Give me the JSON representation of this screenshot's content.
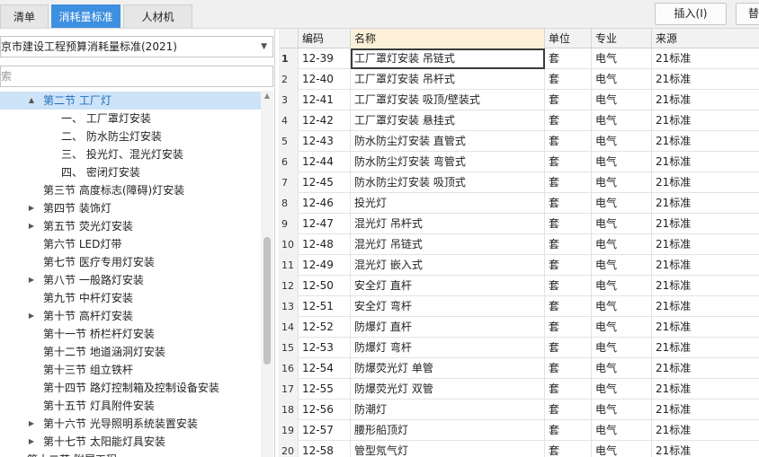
{
  "top_tabs": [
    {
      "label": "清单",
      "active": false
    },
    {
      "label": "消耗量标准",
      "active": true
    },
    {
      "label": "人材机",
      "active": false
    }
  ],
  "toolbar": {
    "insert_label": "插入(I)",
    "replace_label": "替"
  },
  "left": {
    "standard_select": "京市建设工程预算消耗量标准(2021)",
    "search_placeholder": "索",
    "tree": [
      {
        "label": "第二节 工厂灯",
        "level": 1,
        "toggle": "▲",
        "selected": true
      },
      {
        "label": "一、 工厂罩灯安装",
        "level": 2,
        "toggle": "",
        "selected": false
      },
      {
        "label": "二、 防水防尘灯安装",
        "level": 2,
        "toggle": "",
        "selected": false
      },
      {
        "label": "三、 投光灯、混光灯安装",
        "level": 2,
        "toggle": "",
        "selected": false
      },
      {
        "label": "四、 密闭灯安装",
        "level": 2,
        "toggle": "",
        "selected": false
      },
      {
        "label": "第三节 高度标志(障碍)灯安装",
        "level": 1,
        "toggle": "",
        "selected": false
      },
      {
        "label": "第四节 装饰灯",
        "level": 1,
        "toggle": "▶",
        "selected": false
      },
      {
        "label": "第五节 荧光灯安装",
        "level": 1,
        "toggle": "▶",
        "selected": false
      },
      {
        "label": "第六节 LED灯带",
        "level": 1,
        "toggle": "",
        "selected": false
      },
      {
        "label": "第七节 医疗专用灯安装",
        "level": 1,
        "toggle": "",
        "selected": false
      },
      {
        "label": "第八节 一般路灯安装",
        "level": 1,
        "toggle": "▶",
        "selected": false
      },
      {
        "label": "第九节 中杆灯安装",
        "level": 1,
        "toggle": "",
        "selected": false
      },
      {
        "label": "第十节 高杆灯安装",
        "level": 1,
        "toggle": "▶",
        "selected": false
      },
      {
        "label": "第十一节 桥栏杆灯安装",
        "level": 1,
        "toggle": "",
        "selected": false
      },
      {
        "label": "第十二节 地道涵洞灯安装",
        "level": 1,
        "toggle": "",
        "selected": false
      },
      {
        "label": "第十三节 组立铁杆",
        "level": 1,
        "toggle": "",
        "selected": false
      },
      {
        "label": "第十四节 路灯控制箱及控制设备安装",
        "level": 1,
        "toggle": "",
        "selected": false
      },
      {
        "label": "第十五节 灯具附件安装",
        "level": 1,
        "toggle": "",
        "selected": false
      },
      {
        "label": "第十六节 光导照明系统装置安装",
        "level": 1,
        "toggle": "▶",
        "selected": false
      },
      {
        "label": "第十七节 太阳能灯具安装",
        "level": 1,
        "toggle": "▶",
        "selected": false
      },
      {
        "label": "第十二节 附属工程",
        "level": 0,
        "toggle": "",
        "selected": false
      }
    ]
  },
  "table": {
    "headers": {
      "code": "编码",
      "name": "名称",
      "unit": "单位",
      "major": "专业",
      "source": "来源"
    },
    "rows": [
      {
        "no": "1",
        "code": "12-39",
        "name": "工厂罩灯安装 吊链式",
        "unit": "套",
        "major": "电气",
        "source": "21标准",
        "selected": true
      },
      {
        "no": "2",
        "code": "12-40",
        "name": "工厂罩灯安装 吊杆式",
        "unit": "套",
        "major": "电气",
        "source": "21标准",
        "selected": false
      },
      {
        "no": "3",
        "code": "12-41",
        "name": "工厂罩灯安装 吸顶/壁装式",
        "unit": "套",
        "major": "电气",
        "source": "21标准",
        "selected": false
      },
      {
        "no": "4",
        "code": "12-42",
        "name": "工厂罩灯安装 悬挂式",
        "unit": "套",
        "major": "电气",
        "source": "21标准",
        "selected": false
      },
      {
        "no": "5",
        "code": "12-43",
        "name": "防水防尘灯安装 直管式",
        "unit": "套",
        "major": "电气",
        "source": "21标准",
        "selected": false
      },
      {
        "no": "6",
        "code": "12-44",
        "name": "防水防尘灯安装 弯管式",
        "unit": "套",
        "major": "电气",
        "source": "21标准",
        "selected": false
      },
      {
        "no": "7",
        "code": "12-45",
        "name": "防水防尘灯安装 吸顶式",
        "unit": "套",
        "major": "电气",
        "source": "21标准",
        "selected": false
      },
      {
        "no": "8",
        "code": "12-46",
        "name": "投光灯",
        "unit": "套",
        "major": "电气",
        "source": "21标准",
        "selected": false
      },
      {
        "no": "9",
        "code": "12-47",
        "name": "混光灯 吊杆式",
        "unit": "套",
        "major": "电气",
        "source": "21标准",
        "selected": false
      },
      {
        "no": "10",
        "code": "12-48",
        "name": "混光灯 吊链式",
        "unit": "套",
        "major": "电气",
        "source": "21标准",
        "selected": false
      },
      {
        "no": "11",
        "code": "12-49",
        "name": "混光灯 嵌入式",
        "unit": "套",
        "major": "电气",
        "source": "21标准",
        "selected": false
      },
      {
        "no": "12",
        "code": "12-50",
        "name": "安全灯 直杆",
        "unit": "套",
        "major": "电气",
        "source": "21标准",
        "selected": false
      },
      {
        "no": "13",
        "code": "12-51",
        "name": "安全灯 弯杆",
        "unit": "套",
        "major": "电气",
        "source": "21标准",
        "selected": false
      },
      {
        "no": "14",
        "code": "12-52",
        "name": "防爆灯 直杆",
        "unit": "套",
        "major": "电气",
        "source": "21标准",
        "selected": false
      },
      {
        "no": "15",
        "code": "12-53",
        "name": "防爆灯 弯杆",
        "unit": "套",
        "major": "电气",
        "source": "21标准",
        "selected": false
      },
      {
        "no": "16",
        "code": "12-54",
        "name": "防爆荧光灯 单管",
        "unit": "套",
        "major": "电气",
        "source": "21标准",
        "selected": false
      },
      {
        "no": "17",
        "code": "12-55",
        "name": "防爆荧光灯 双管",
        "unit": "套",
        "major": "电气",
        "source": "21标准",
        "selected": false
      },
      {
        "no": "18",
        "code": "12-56",
        "name": "防潮灯",
        "unit": "套",
        "major": "电气",
        "source": "21标准",
        "selected": false
      },
      {
        "no": "19",
        "code": "12-57",
        "name": "腰形船顶灯",
        "unit": "套",
        "major": "电气",
        "source": "21标准",
        "selected": false
      },
      {
        "no": "20",
        "code": "12-58",
        "name": "管型氖气灯",
        "unit": "套",
        "major": "电气",
        "source": "21标准",
        "selected": false
      }
    ]
  },
  "colors": {
    "accent": "#3d8fe0",
    "tree_selected_bg": "#cde3f7",
    "name_header_bg": "#fdf0d8"
  }
}
